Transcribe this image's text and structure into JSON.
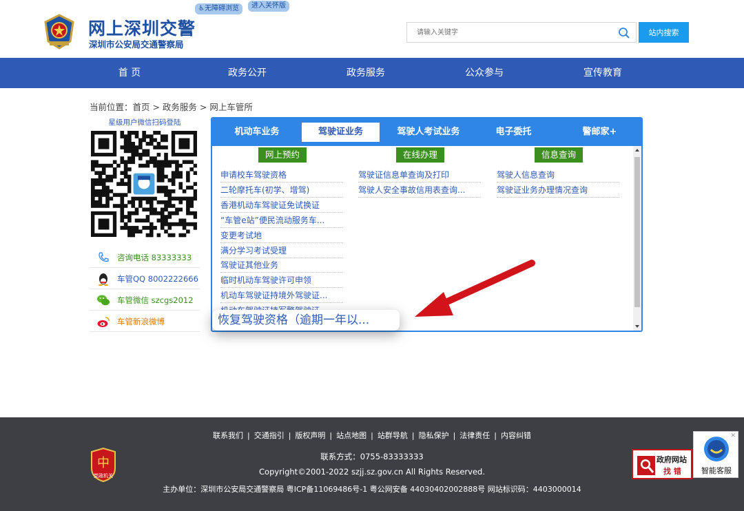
{
  "header": {
    "title": "网上深圳交警",
    "subtitle": "深圳市公安局交通警察局",
    "badge_accessibility": "♿无障碍浏览",
    "badge_care": "进入关怀版",
    "search_placeholder": "请输入关键字",
    "search_button": "站内搜索"
  },
  "nav": {
    "items": [
      "首 页",
      "政务公开",
      "政务服务",
      "公众参与",
      "宣传教育"
    ]
  },
  "breadcrumb": "当前位置：首页 > 政务服务 > 网上车管所",
  "sidebar": {
    "wechat_caption": "星级用户微信扫码登陆",
    "contacts": [
      {
        "icon": "phone-icon",
        "text": "咨询电话 83333333",
        "color": "#3b8f1e"
      },
      {
        "icon": "qq-icon",
        "text": "车管QQ 8002222666",
        "color": "#2f5ab6"
      },
      {
        "icon": "wechat-icon",
        "text": "车管微信 szcgs2012",
        "color": "#3b8f1e"
      },
      {
        "icon": "weibo-icon",
        "text": "车管新浪微博",
        "color": "#e07a00"
      }
    ]
  },
  "panel": {
    "tabs": [
      "机动车业务",
      "驾驶证业务",
      "驾驶人考试业务",
      "电子委托",
      "警邮家+"
    ],
    "active_tab": 1,
    "columns": [
      {
        "heading": "网上预约",
        "links": [
          "申请校车驾驶资格",
          "二轮摩托车(初学、增驾)",
          "香港机动车驾驶证免试换证",
          "“车管e站”便民流动服务车...",
          "变更考试地",
          "满分学习考试受理",
          "驾驶证其他业务",
          "临时机动车驾驶许可申领",
          "机动车驾驶证持境外驾驶证...",
          "机动车驾驶证持军警驾驶证..."
        ]
      },
      {
        "heading": "在线办理",
        "links": [
          "驾驶证信息单查询及打印",
          "驾驶人安全事故信用表查询..."
        ]
      },
      {
        "heading": "信息查询",
        "links": [
          "驾驶人信息查询",
          "驾驶证业务办理情况查询"
        ]
      }
    ],
    "tooltip": "恢复驾驶资格（逾期一年以..."
  },
  "footer": {
    "links": [
      "联系我们",
      "交通指引",
      "版权声明",
      "站点地图",
      "站群导航",
      "隐私保护",
      "法律责任",
      "内容纠错"
    ],
    "contact": "联系方式：0755-83333333",
    "copyright": "Copyright©2001-2022 szjj.sz.gov.cn   All Rights Reserved.",
    "sponsor": "主办单位：深圳市公安局交通警察局  粤ICP备11069486号-1  粤公网安备 44030402002888号  网站标识码：4403000014",
    "dangzheng_label": "党政机关",
    "find_error_line1": "政府网站",
    "find_error_line2": "找 错",
    "smart_service": "智能客服"
  },
  "colors": {
    "brand_blue": "#1e50a2",
    "nav_blue": "#2f5ab6",
    "panel_blue": "#2f86e6",
    "green": "#3b8f1e",
    "footer_bg": "#3e3f45",
    "arrow_red": "#d0141a"
  }
}
